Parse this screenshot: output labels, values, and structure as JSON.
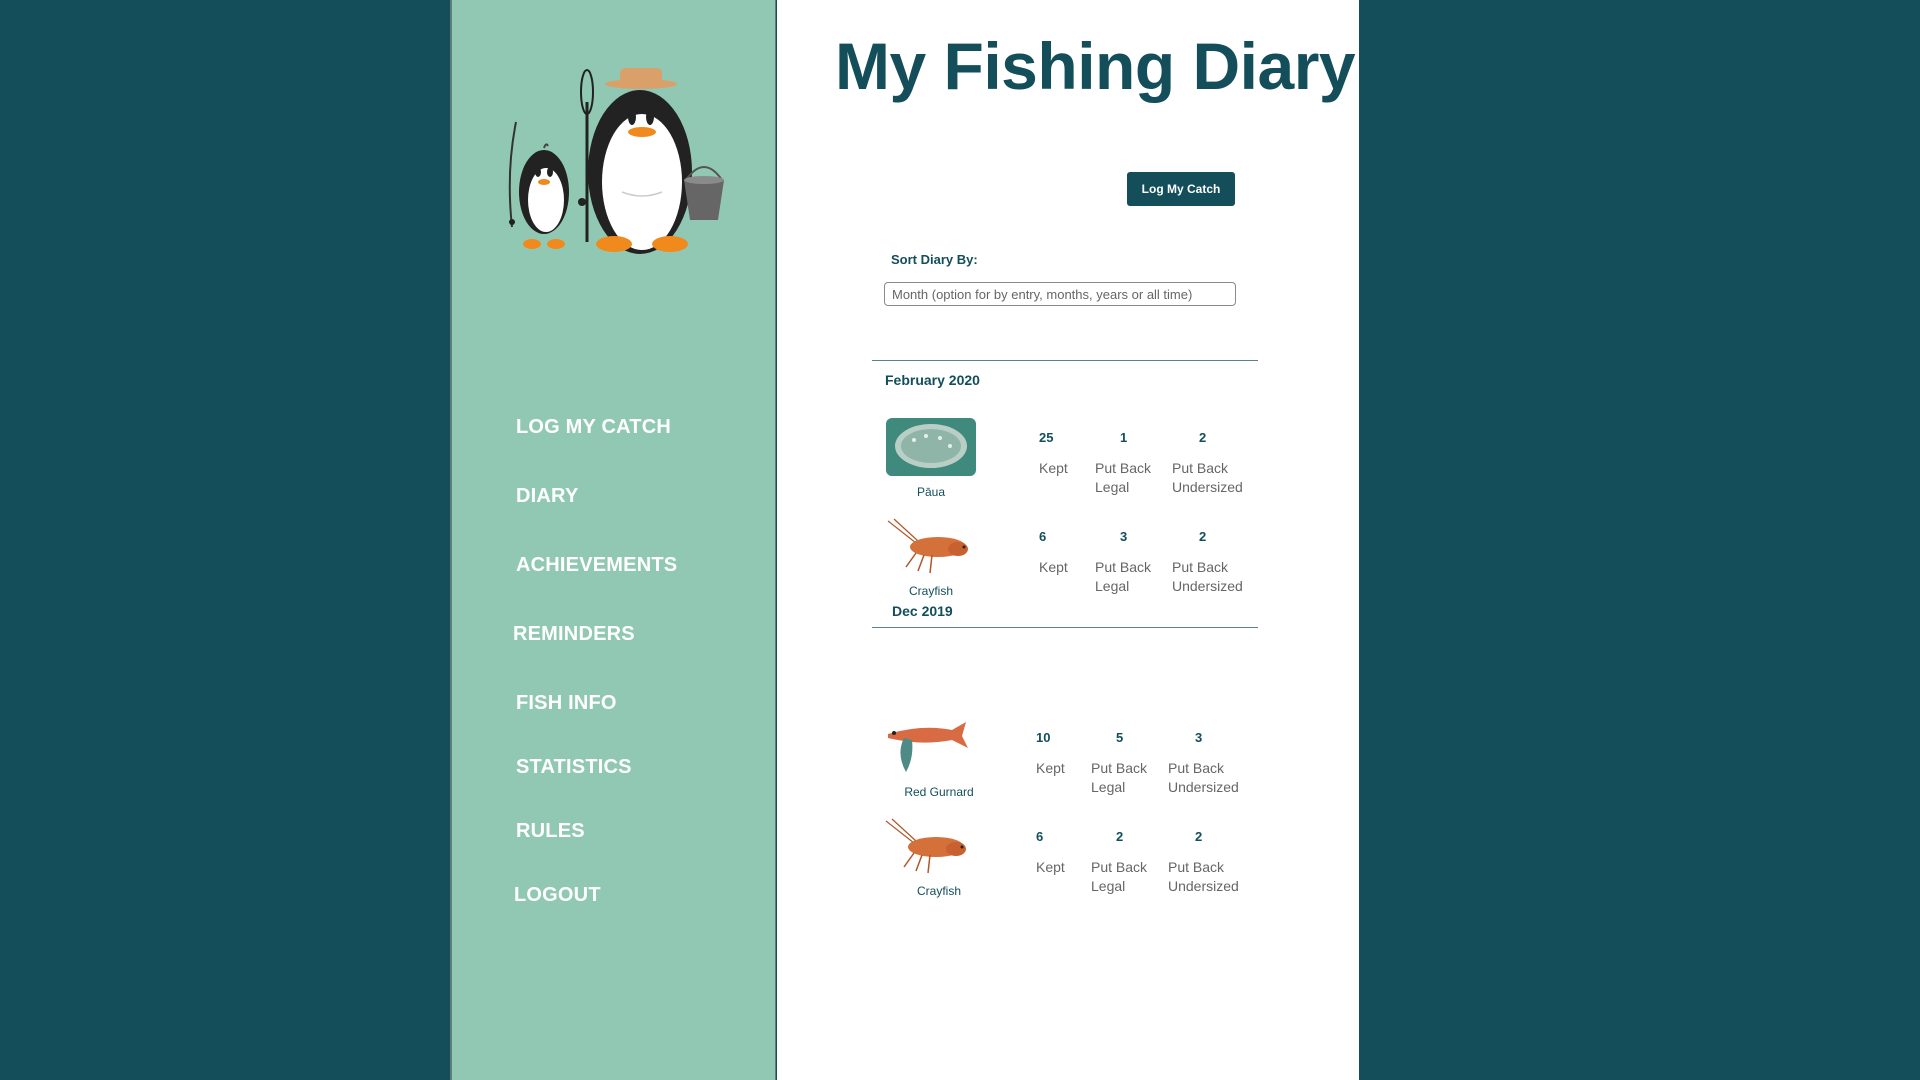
{
  "app": {
    "title": "My Fishing Diary"
  },
  "nav": {
    "items": [
      {
        "label": "LOG MY CATCH"
      },
      {
        "label": "DIARY"
      },
      {
        "label": "ACHIEVEMENTS"
      },
      {
        "label": "REMINDERS"
      },
      {
        "label": "FISH INFO"
      },
      {
        "label": "STATISTICS"
      },
      {
        "label": "RULES"
      },
      {
        "label": "LOGOUT"
      }
    ]
  },
  "actions": {
    "log_catch_label": "Log My Catch"
  },
  "sort": {
    "label": "Sort Diary By:",
    "placeholder": "Month (option for by entry, months, years or all time)"
  },
  "stat_labels": {
    "kept": "Kept",
    "put_back_legal_1": "Put Back",
    "put_back_legal_2": "Legal",
    "put_back_undersized_1": "Put Back",
    "put_back_undersized_2": "Undersized"
  },
  "diary": [
    {
      "month": "February 2020",
      "entries": [
        {
          "species": "Pāua",
          "image": "paua-shell",
          "kept": "25",
          "put_back_legal": "1",
          "put_back_undersized": "2"
        },
        {
          "species": "Crayfish",
          "image": "crayfish",
          "kept": "6",
          "put_back_legal": "3",
          "put_back_undersized": "2"
        }
      ]
    },
    {
      "month": "Dec 2019",
      "entries": [
        {
          "species": "Red Gurnard",
          "image": "red-gurnard",
          "kept": "10",
          "put_back_legal": "5",
          "put_back_undersized": "3"
        },
        {
          "species": "Crayfish",
          "image": "crayfish",
          "kept": "6",
          "put_back_legal": "2",
          "put_back_undersized": "2"
        }
      ]
    }
  ],
  "colors": {
    "background": "#134e5a",
    "sidebar": "#91c8b3",
    "accent": "#134e5a",
    "main": "#ffffff"
  }
}
